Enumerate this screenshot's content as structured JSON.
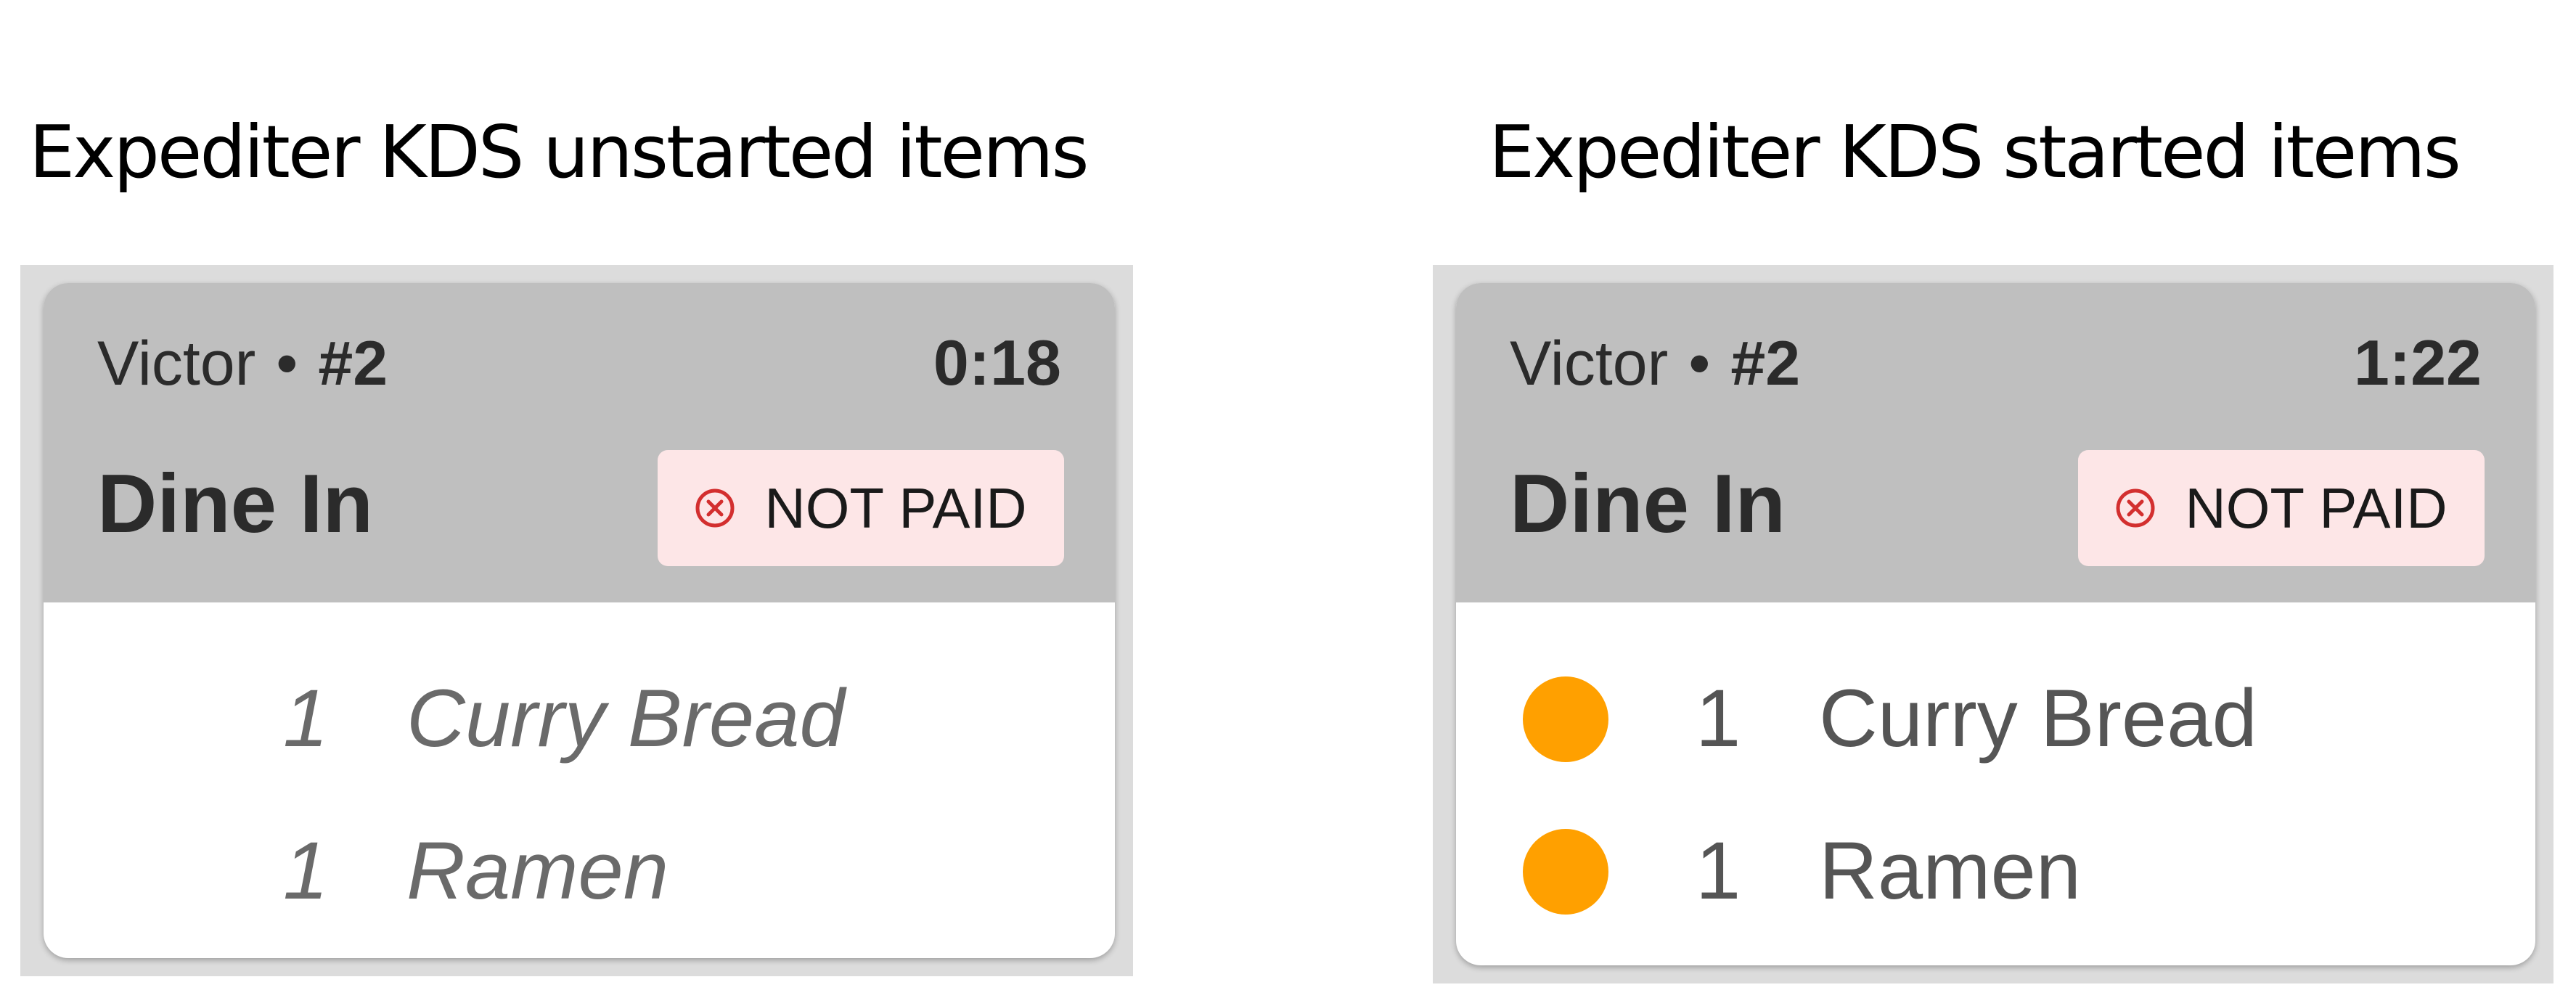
{
  "panels": [
    {
      "title": "Expediter KDS unstarted items",
      "server": "Victor",
      "separator": "•",
      "ticket": "#2",
      "timer": "0:18",
      "order_type": "Dine In",
      "payment_status": "NOT PAID",
      "items": [
        {
          "qty": "1",
          "name": "Curry Bread"
        },
        {
          "qty": "1",
          "name": "Ramen"
        }
      ]
    },
    {
      "title": "Expediter KDS started items",
      "server": "Victor",
      "separator": "•",
      "ticket": "#2",
      "timer": "1:22",
      "order_type": "Dine In",
      "payment_status": "NOT PAID",
      "items": [
        {
          "qty": "1",
          "name": "Curry Bread",
          "status_icon": "orange-dot-icon"
        },
        {
          "qty": "1",
          "name": "Ramen",
          "status_icon": "orange-dot-icon"
        }
      ]
    }
  ],
  "colors": {
    "header_bg": "#bfbfbf",
    "frame_bg": "#dcdcdc",
    "badge_bg": "#fde6e7",
    "badge_icon": "#d32f2f",
    "started_dot": "#ffa000"
  }
}
